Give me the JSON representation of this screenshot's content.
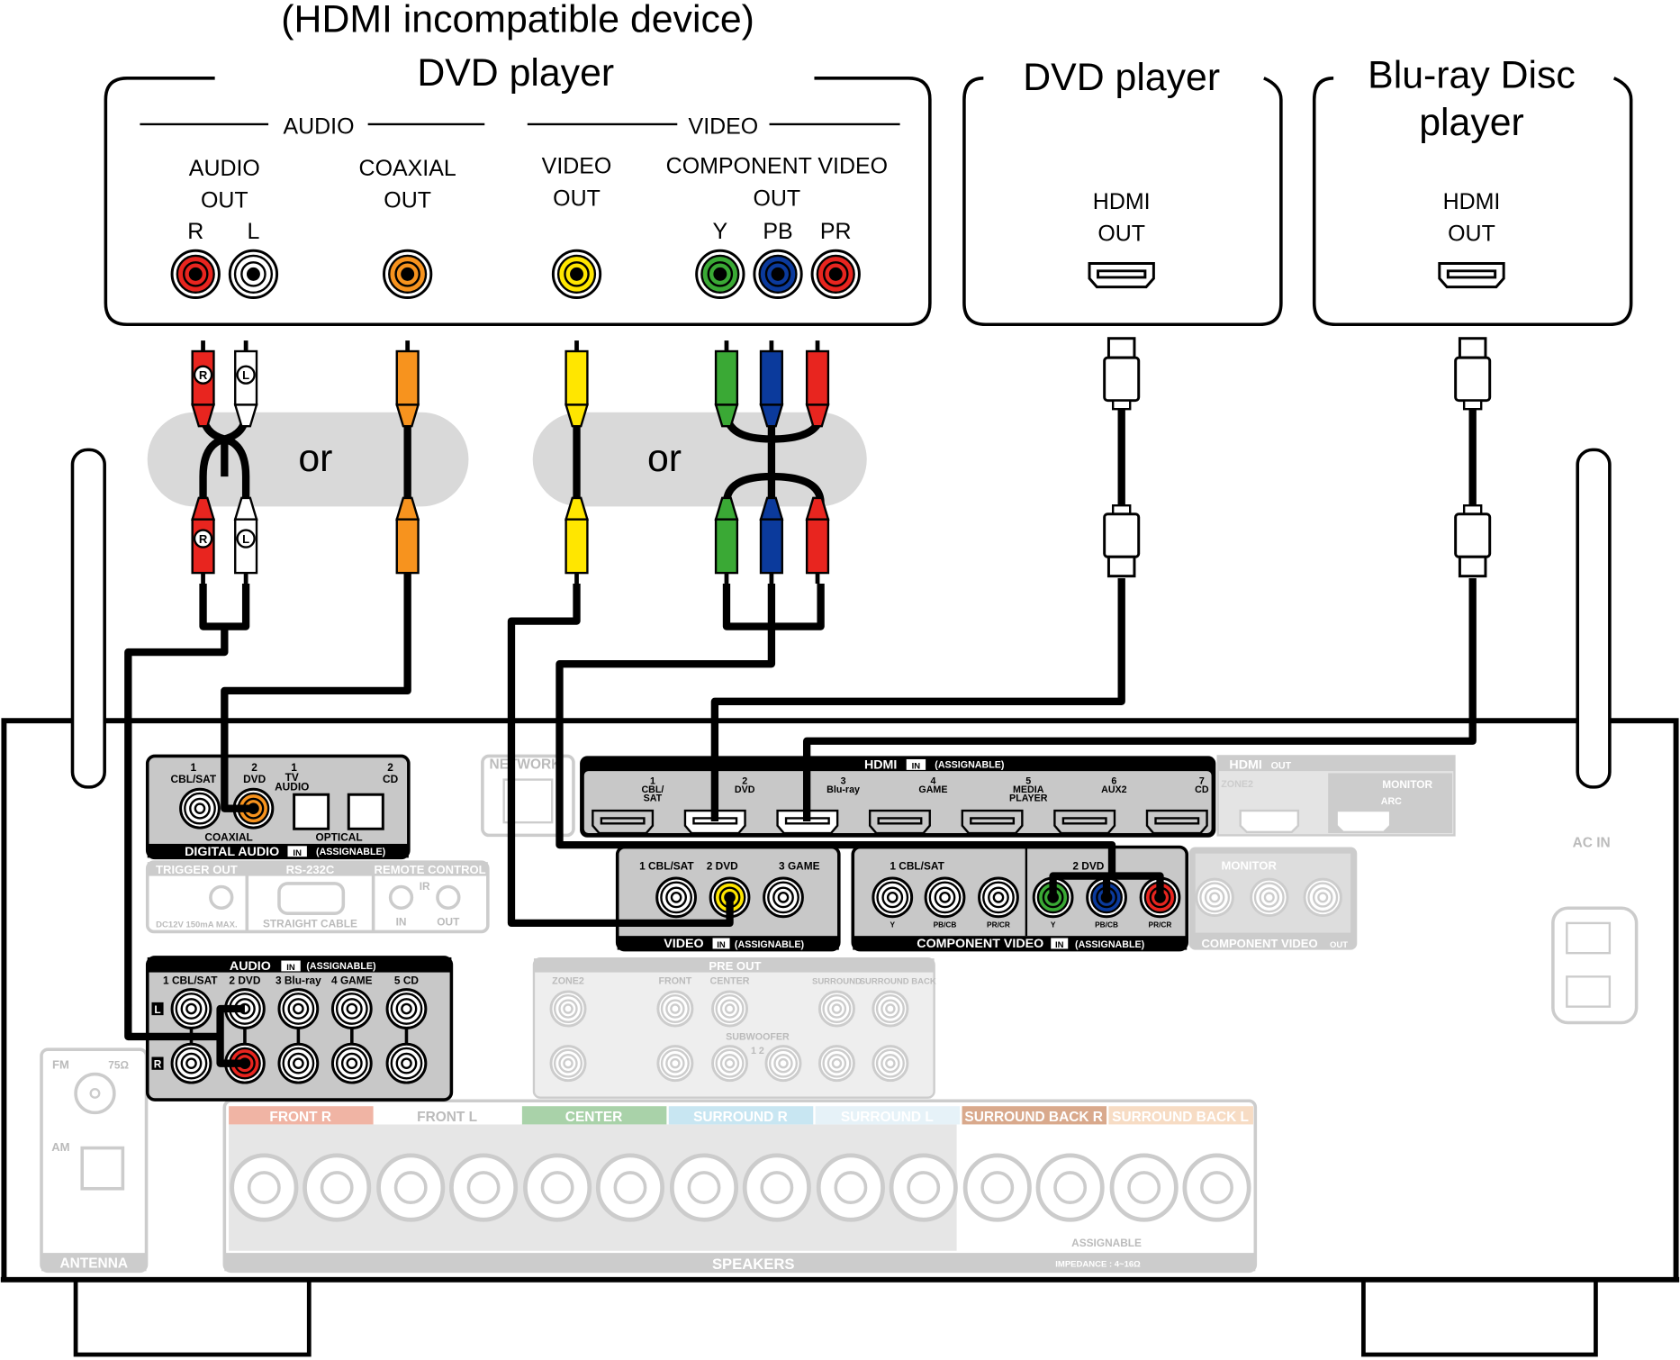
{
  "devices": {
    "analog_dvd": {
      "note": "(HDMI incompatible device)",
      "title": "DVD player",
      "audio_section": "AUDIO",
      "video_section": "VIDEO",
      "audio_out": [
        "AUDIO",
        "OUT"
      ],
      "audio_channels": [
        "R",
        "L"
      ],
      "coaxial_out": [
        "COAXIAL",
        "OUT"
      ],
      "video_out": [
        "VIDEO",
        "OUT"
      ],
      "component_out": [
        "COMPONENT VIDEO",
        "OUT"
      ],
      "component_channels": [
        "Y",
        "PB",
        "PR"
      ]
    },
    "hdmi_dvd": {
      "title": "DVD player",
      "port": [
        "HDMI",
        "OUT"
      ]
    },
    "bluray": {
      "title": [
        "Blu-ray Disc",
        "player"
      ],
      "port": [
        "HDMI",
        "OUT"
      ]
    }
  },
  "cables": {
    "or_label": "or",
    "plug_r": "R",
    "plug_l": "L"
  },
  "jack_colors": {
    "red": "#e8251f",
    "white": "#ffffff",
    "orange": "#f7931e",
    "yellow": "#ffe600",
    "green": "#3aa935",
    "blue": "#0b3a9c"
  },
  "receiver": {
    "digital_audio": {
      "inputs": [
        "1",
        "CBL/SAT",
        "2",
        "DVD",
        "1",
        "TV",
        "AUDIO",
        "2",
        "CD"
      ],
      "coaxial": "COAXIAL",
      "optical": "OPTICAL",
      "title": "DIGITAL AUDIO",
      "in": "IN",
      "assignable": "(ASSIGNABLE)"
    },
    "network": "NETWORK",
    "trigger_out": "TRIGGER OUT",
    "trigger_spec": "DC12V 150mA MAX.",
    "rs232c": "RS-232C",
    "rs232c_note": "STRAIGHT CABLE",
    "remote_control": "REMOTE CONTROL",
    "ir": "IR",
    "remote_in": "IN",
    "remote_out": "OUT",
    "hdmi_in": {
      "title": "HDMI",
      "in": "IN",
      "assignable": "(ASSIGNABLE)",
      "ports": [
        [
          "1",
          "CBL/",
          "SAT"
        ],
        [
          "2",
          "DVD"
        ],
        [
          "3",
          "Blu-ray"
        ],
        [
          "4",
          "GAME"
        ],
        [
          "5",
          "MEDIA",
          "PLAYER"
        ],
        [
          "6",
          "AUX2"
        ],
        [
          "7",
          "CD"
        ]
      ]
    },
    "hdmi_out": {
      "title": "HDMI",
      "out": "OUT",
      "zone2": "ZONE2",
      "monitor": "MONITOR",
      "arc": "ARC"
    },
    "video_in": {
      "inputs": [
        "1 CBL/SAT",
        "2 DVD",
        "3 GAME"
      ],
      "title": "VIDEO",
      "in": "IN",
      "assignable": "(ASSIGNABLE)"
    },
    "component_in": {
      "inputs": [
        "1 CBL/SAT",
        "2 DVD"
      ],
      "channels": [
        "Y",
        "PB/CB",
        "PR/CR"
      ],
      "title": "COMPONENT VIDEO",
      "in": "IN",
      "assignable": "(ASSIGNABLE)"
    },
    "component_out": {
      "monitor": "MONITOR",
      "title": "COMPONENT VIDEO",
      "out": "OUT"
    },
    "audio_in": {
      "title": "AUDIO",
      "in": "IN",
      "assignable": "(ASSIGNABLE)",
      "inputs": [
        "1 CBL/SAT",
        "2 DVD",
        "3 Blu-ray",
        "4 GAME",
        "5 CD"
      ],
      "l": "L",
      "r": "R"
    },
    "pre_out": {
      "title": "PRE OUT",
      "labels": [
        "ZONE2",
        "FRONT",
        "CENTER",
        "SURROUND",
        "SURROUND BACK"
      ],
      "subwoofer": "SUBWOOFER",
      "sub_nums": "1 2"
    },
    "antenna": {
      "fm": "FM",
      "ohm": "75Ω",
      "am": "AM",
      "title": "ANTENNA"
    },
    "speakers": {
      "channels": [
        {
          "label": "FRONT R",
          "color": "#f0b4a4"
        },
        {
          "label": "FRONT L",
          "color": "#ffffff"
        },
        {
          "label": "CENTER",
          "color": "#a9d2a9"
        },
        {
          "label": "SURROUND R",
          "color": "#c8e6f2"
        },
        {
          "label": "SURROUND L",
          "color": "#e6f2f8"
        },
        {
          "label": "SURROUND BACK R",
          "color": "#d9a98c"
        },
        {
          "label": "SURROUND BACK L",
          "color": "#f7dcc4"
        }
      ],
      "assignable": "ASSIGNABLE",
      "title": "SPEAKERS",
      "impedance": "IMPEDANCE : 4~16Ω"
    },
    "ac_in": "AC IN"
  }
}
